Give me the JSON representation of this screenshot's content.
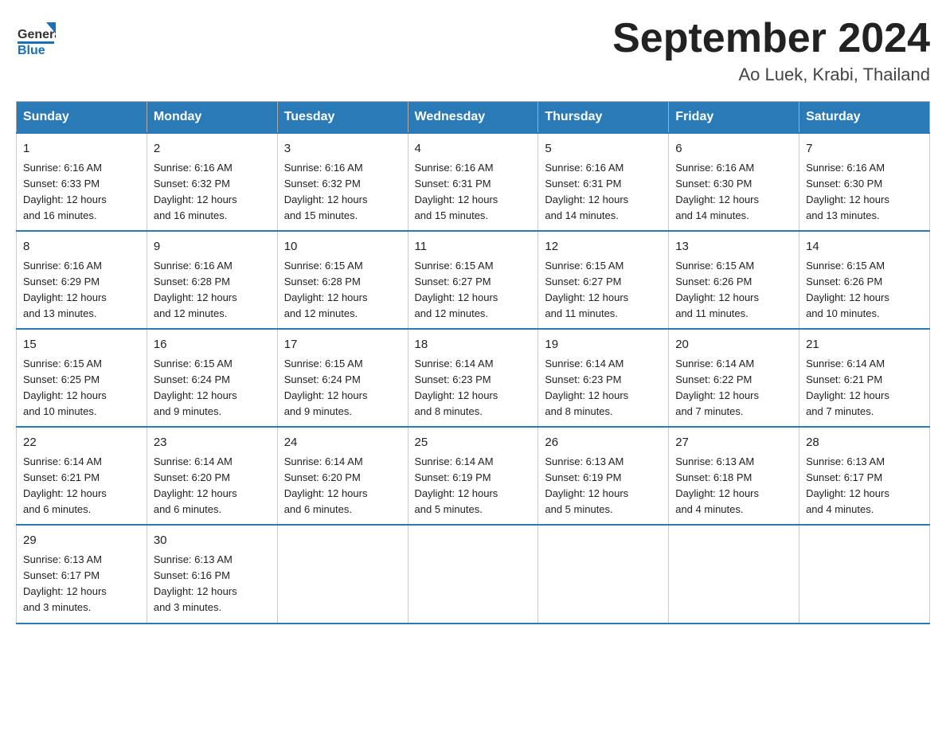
{
  "header": {
    "logo_general": "General",
    "logo_blue": "Blue",
    "month_year": "September 2024",
    "location": "Ao Luek, Krabi, Thailand"
  },
  "days_of_week": [
    "Sunday",
    "Monday",
    "Tuesday",
    "Wednesday",
    "Thursday",
    "Friday",
    "Saturday"
  ],
  "weeks": [
    [
      {
        "day": "1",
        "sunrise": "6:16 AM",
        "sunset": "6:33 PM",
        "daylight": "12 hours and 16 minutes."
      },
      {
        "day": "2",
        "sunrise": "6:16 AM",
        "sunset": "6:32 PM",
        "daylight": "12 hours and 16 minutes."
      },
      {
        "day": "3",
        "sunrise": "6:16 AM",
        "sunset": "6:32 PM",
        "daylight": "12 hours and 15 minutes."
      },
      {
        "day": "4",
        "sunrise": "6:16 AM",
        "sunset": "6:31 PM",
        "daylight": "12 hours and 15 minutes."
      },
      {
        "day": "5",
        "sunrise": "6:16 AM",
        "sunset": "6:31 PM",
        "daylight": "12 hours and 14 minutes."
      },
      {
        "day": "6",
        "sunrise": "6:16 AM",
        "sunset": "6:30 PM",
        "daylight": "12 hours and 14 minutes."
      },
      {
        "day": "7",
        "sunrise": "6:16 AM",
        "sunset": "6:30 PM",
        "daylight": "12 hours and 13 minutes."
      }
    ],
    [
      {
        "day": "8",
        "sunrise": "6:16 AM",
        "sunset": "6:29 PM",
        "daylight": "12 hours and 13 minutes."
      },
      {
        "day": "9",
        "sunrise": "6:16 AM",
        "sunset": "6:28 PM",
        "daylight": "12 hours and 12 minutes."
      },
      {
        "day": "10",
        "sunrise": "6:15 AM",
        "sunset": "6:28 PM",
        "daylight": "12 hours and 12 minutes."
      },
      {
        "day": "11",
        "sunrise": "6:15 AM",
        "sunset": "6:27 PM",
        "daylight": "12 hours and 12 minutes."
      },
      {
        "day": "12",
        "sunrise": "6:15 AM",
        "sunset": "6:27 PM",
        "daylight": "12 hours and 11 minutes."
      },
      {
        "day": "13",
        "sunrise": "6:15 AM",
        "sunset": "6:26 PM",
        "daylight": "12 hours and 11 minutes."
      },
      {
        "day": "14",
        "sunrise": "6:15 AM",
        "sunset": "6:26 PM",
        "daylight": "12 hours and 10 minutes."
      }
    ],
    [
      {
        "day": "15",
        "sunrise": "6:15 AM",
        "sunset": "6:25 PM",
        "daylight": "12 hours and 10 minutes."
      },
      {
        "day": "16",
        "sunrise": "6:15 AM",
        "sunset": "6:24 PM",
        "daylight": "12 hours and 9 minutes."
      },
      {
        "day": "17",
        "sunrise": "6:15 AM",
        "sunset": "6:24 PM",
        "daylight": "12 hours and 9 minutes."
      },
      {
        "day": "18",
        "sunrise": "6:14 AM",
        "sunset": "6:23 PM",
        "daylight": "12 hours and 8 minutes."
      },
      {
        "day": "19",
        "sunrise": "6:14 AM",
        "sunset": "6:23 PM",
        "daylight": "12 hours and 8 minutes."
      },
      {
        "day": "20",
        "sunrise": "6:14 AM",
        "sunset": "6:22 PM",
        "daylight": "12 hours and 7 minutes."
      },
      {
        "day": "21",
        "sunrise": "6:14 AM",
        "sunset": "6:21 PM",
        "daylight": "12 hours and 7 minutes."
      }
    ],
    [
      {
        "day": "22",
        "sunrise": "6:14 AM",
        "sunset": "6:21 PM",
        "daylight": "12 hours and 6 minutes."
      },
      {
        "day": "23",
        "sunrise": "6:14 AM",
        "sunset": "6:20 PM",
        "daylight": "12 hours and 6 minutes."
      },
      {
        "day": "24",
        "sunrise": "6:14 AM",
        "sunset": "6:20 PM",
        "daylight": "12 hours and 6 minutes."
      },
      {
        "day": "25",
        "sunrise": "6:14 AM",
        "sunset": "6:19 PM",
        "daylight": "12 hours and 5 minutes."
      },
      {
        "day": "26",
        "sunrise": "6:13 AM",
        "sunset": "6:19 PM",
        "daylight": "12 hours and 5 minutes."
      },
      {
        "day": "27",
        "sunrise": "6:13 AM",
        "sunset": "6:18 PM",
        "daylight": "12 hours and 4 minutes."
      },
      {
        "day": "28",
        "sunrise": "6:13 AM",
        "sunset": "6:17 PM",
        "daylight": "12 hours and 4 minutes."
      }
    ],
    [
      {
        "day": "29",
        "sunrise": "6:13 AM",
        "sunset": "6:17 PM",
        "daylight": "12 hours and 3 minutes."
      },
      {
        "day": "30",
        "sunrise": "6:13 AM",
        "sunset": "6:16 PM",
        "daylight": "12 hours and 3 minutes."
      },
      null,
      null,
      null,
      null,
      null
    ]
  ],
  "labels": {
    "sunrise": "Sunrise:",
    "sunset": "Sunset:",
    "daylight": "Daylight:"
  }
}
